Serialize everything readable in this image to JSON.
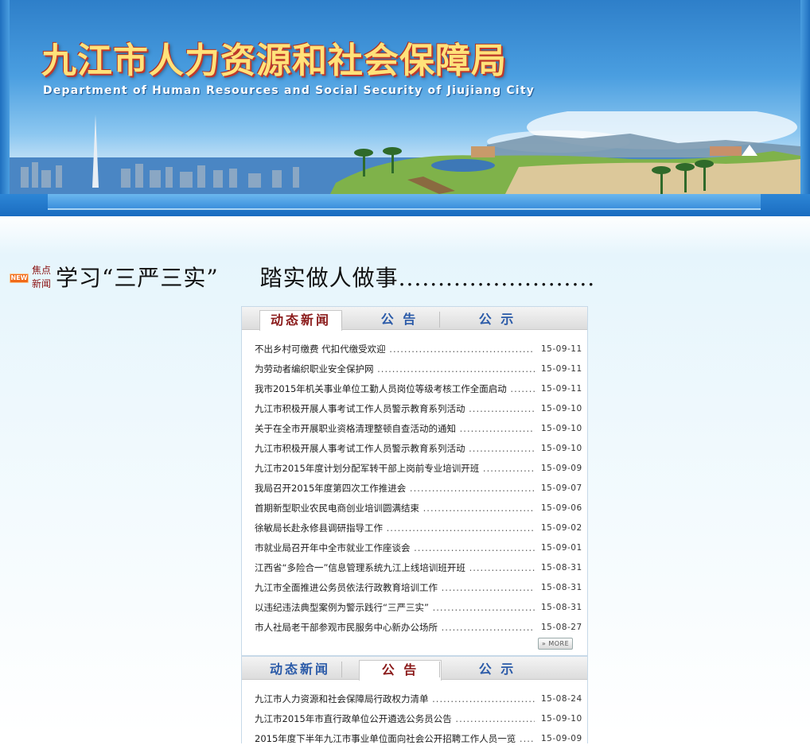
{
  "header": {
    "title_cn": "九江市人力资源和社会保障局",
    "title_en": "Department of Human Resources and Social  Security of Jiujiang City"
  },
  "headline": {
    "new_badge": "NEW",
    "label_line1": "焦点",
    "label_line2": "新闻",
    "text_part1": "学习“三严三实”",
    "text_part2": "踏实做人做事........................."
  },
  "tabs": [
    "动态新闻",
    "公 告",
    "公 示"
  ],
  "news_panel": {
    "active_tab": 0,
    "items": [
      {
        "title": "不出乡村可缴费 代扣代缴受欢迎",
        "date": "15-09-11"
      },
      {
        "title": "为劳动者编织职业安全保护网",
        "date": "15-09-11"
      },
      {
        "title": "我市2015年机关事业单位工勤人员岗位等级考核工作全面启动",
        "date": "15-09-11"
      },
      {
        "title": "九江市积极开展人事考试工作人员警示教育系列活动",
        "date": "15-09-10"
      },
      {
        "title": "关于在全市开展职业资格清理整顿自查活动的通知",
        "date": "15-09-10"
      },
      {
        "title": "九江市积极开展人事考试工作人员警示教育系列活动",
        "date": "15-09-10"
      },
      {
        "title": "九江市2015年度计划分配军转干部上岗前专业培训开班",
        "date": "15-09-09"
      },
      {
        "title": "我局召开2015年度第四次工作推进会",
        "date": "15-09-07"
      },
      {
        "title": "首期新型职业农民电商创业培训圆满结束",
        "date": "15-09-06"
      },
      {
        "title": "徐敏局长赴永修县调研指导工作",
        "date": "15-09-02"
      },
      {
        "title": "市就业局召开年中全市就业工作座谈会",
        "date": "15-09-01"
      },
      {
        "title": "江西省“多险合一”信息管理系统九江上线培训班开班",
        "date": "15-08-31"
      },
      {
        "title": "九江市全面推进公务员依法行政教育培训工作",
        "date": "15-08-31"
      },
      {
        "title": "以违纪违法典型案例为警示践行“三严三实”",
        "date": "15-08-31"
      },
      {
        "title": "市人社局老干部参观市民服务中心新办公场所",
        "date": "15-08-27"
      }
    ],
    "more_label": "» MORE"
  },
  "notice_panel": {
    "active_tab": 1,
    "items": [
      {
        "title": "九江市人力资源和社会保障局行政权力清单",
        "date": "15-08-24"
      },
      {
        "title": "九江市2015年市直行政单位公开遴选公务员公告",
        "date": "15-09-10"
      },
      {
        "title": "2015年度下半年九江市事业单位面向社会公开招聘工作人员一览",
        "date": "15-09-09"
      }
    ]
  }
}
